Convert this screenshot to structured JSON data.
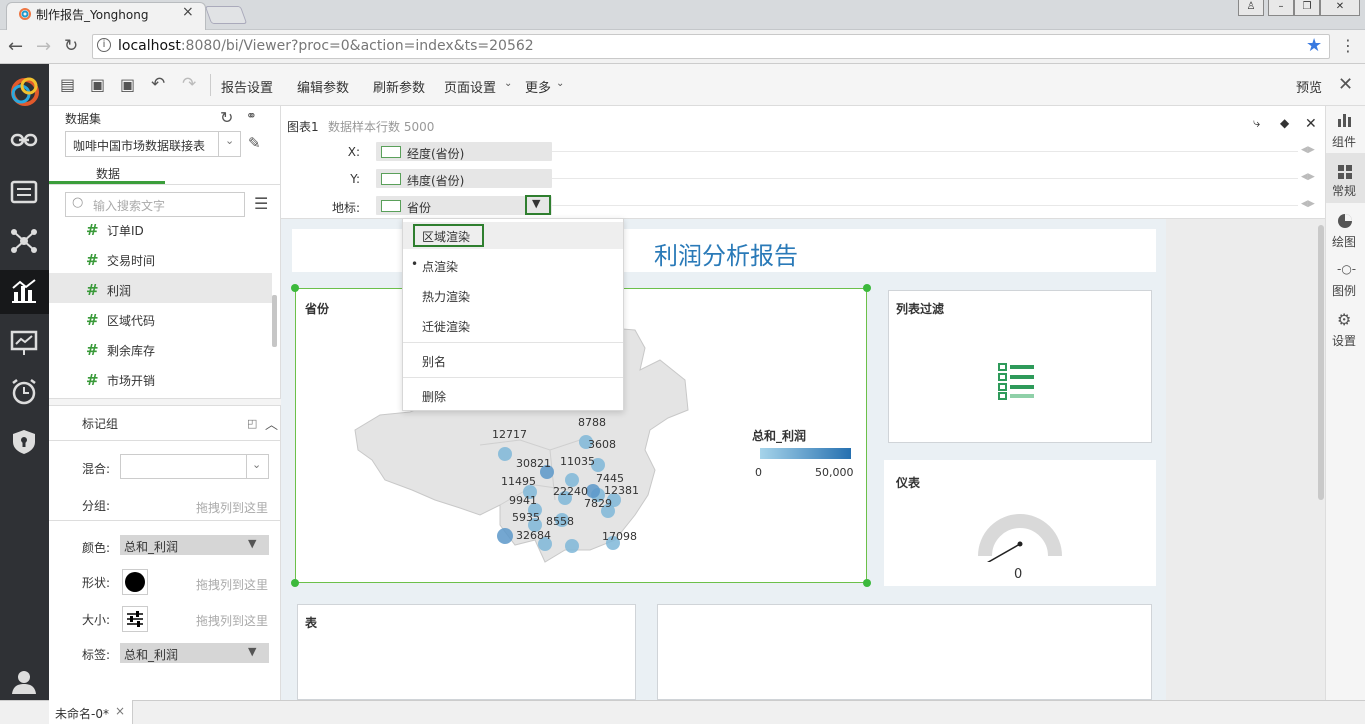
{
  "browser": {
    "tab_title": "制作报告_Yonghong",
    "url_host": "localhost",
    "url_rest": ":8080/bi/Viewer?proc=0&action=index&ts=20562",
    "window_buttons": [
      "user-icon",
      "minimize-icon",
      "restore-icon",
      "close-icon"
    ]
  },
  "toolbar": {
    "items": [
      "报告设置",
      "编辑参数",
      "刷新参数",
      "页面设置",
      "更多"
    ],
    "preview": "预览"
  },
  "dataset": {
    "label": "数据集",
    "selected": "咖啡中国市场数据联接表",
    "tab": "数据",
    "search_placeholder": "输入搜索文字",
    "fields": [
      "订单ID",
      "交易时间",
      "利润",
      "区域代码",
      "剩余库存",
      "市场开销"
    ]
  },
  "markgroup": {
    "title": "标记组",
    "mix_label": "混合:",
    "group_label": "分组:",
    "group_hint": "拖拽列到这里",
    "color_label": "颜色:",
    "color_value": "总和_利润",
    "shape_label": "形状:",
    "shape_hint": "拖拽列到这里",
    "size_label": "大小:",
    "size_hint": "拖拽列到这里",
    "tag_label": "标签:",
    "tag_value": "总和_利润"
  },
  "binding": {
    "chart_name": "图表1",
    "sample": "数据样本行数 5000",
    "x_label": "X:",
    "x_value": "经度(省份)",
    "y_label": "Y:",
    "y_value": "纬度(省份)",
    "geo_label": "地标:",
    "geo_value": "省份"
  },
  "menu": {
    "items": [
      "区域渲染",
      "点渲染",
      "热力渲染",
      "迁徙渲染",
      "别名",
      "删除"
    ]
  },
  "report": {
    "title": "利润分析报告",
    "map_title": "省份",
    "legend_title": "总和_利润",
    "legend_min": "0",
    "legend_max": "50,000",
    "filter_title": "列表过滤",
    "gauge_title": "仪表",
    "gauge_value": "0",
    "table_title": "表"
  },
  "map_labels": [
    "8788",
    "12717",
    "3608",
    "30821",
    "11035",
    "7445",
    "11495",
    "22240",
    "12381",
    "9941",
    "7829",
    "5935",
    "8558",
    "32684",
    "17098"
  ],
  "right_sidebar": [
    "组件",
    "常规",
    "绘图",
    "图例",
    "设置"
  ],
  "bottom": {
    "tab": "未命名-0*"
  },
  "colors": {
    "accent_green": "#3b9e3b",
    "title_blue": "#2a7ab8",
    "nav_dark": "#2f3135"
  }
}
